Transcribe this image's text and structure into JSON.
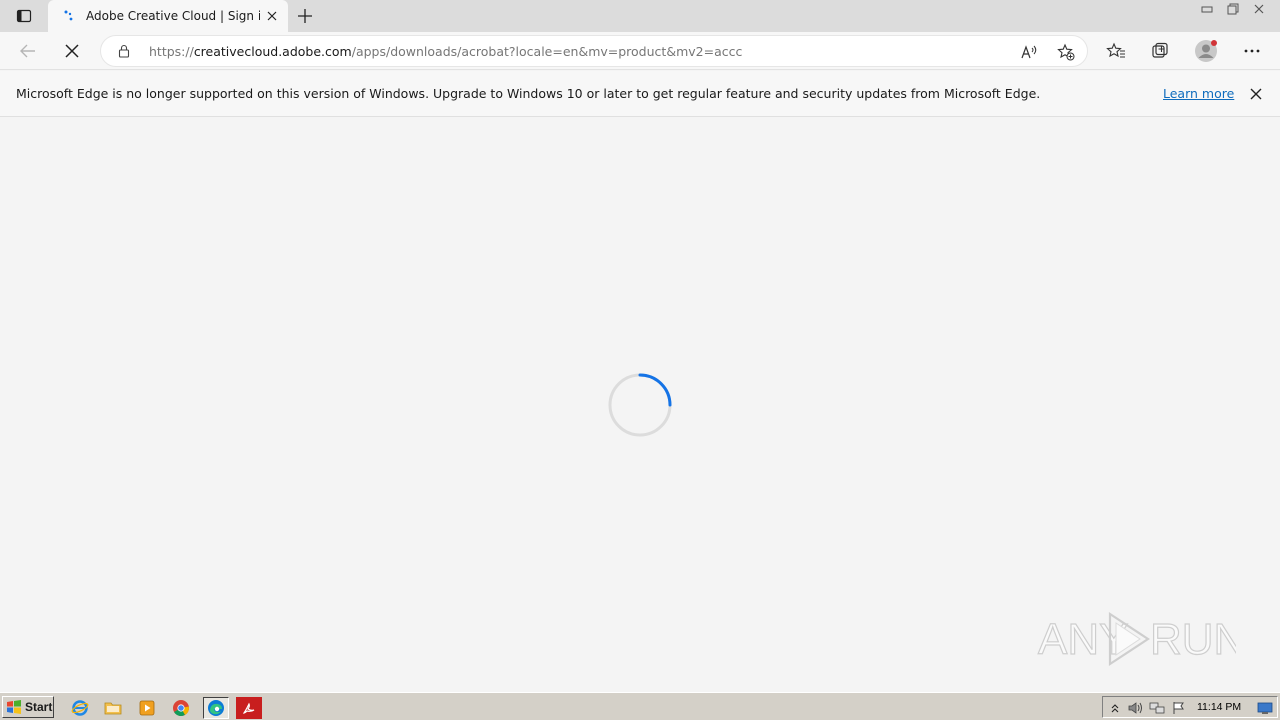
{
  "browser": {
    "tab": {
      "title": "Adobe Creative Cloud | Sign in",
      "favicon": "adobe-loading-dots-icon"
    },
    "address_bar": {
      "url_prefix": "https://",
      "url_host": "creativecloud.adobe.com",
      "url_path": "/apps/downloads/acrobat?locale=en&mv=product&mv2=accc"
    },
    "state": "loading"
  },
  "infobar": {
    "message": "Microsoft Edge is no longer supported on this version of Windows. Upgrade to Windows 10 or later to get regular feature and security updates from Microsoft Edge.",
    "link_label": "Learn more"
  },
  "page": {
    "state": "loading-spinner"
  },
  "watermark": {
    "text_left": "ANY",
    "text_right": "RUN"
  },
  "taskbar": {
    "start_label": "Start",
    "quick_launch": [
      "internet-explorer-icon",
      "folder-icon",
      "media-player-icon",
      "chrome-icon",
      "edge-icon",
      "acrobat-icon"
    ],
    "clock": "11:14 PM"
  },
  "colors": {
    "accent": "#0f6cbd",
    "spinner": "#1473e6",
    "taskbar": "#d4d0c8"
  }
}
